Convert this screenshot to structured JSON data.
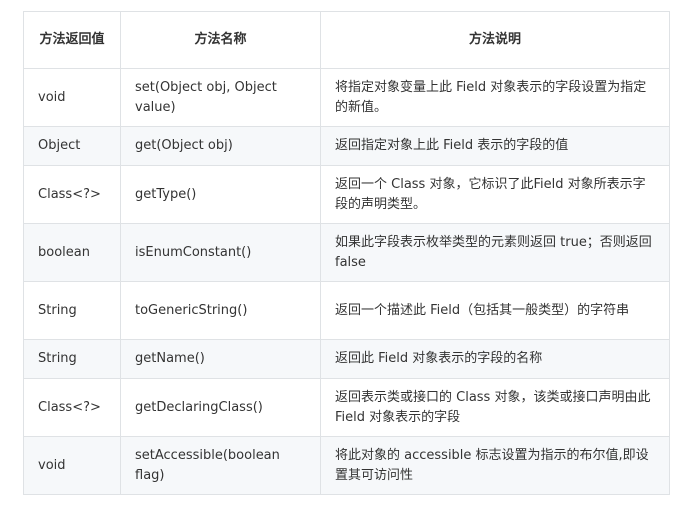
{
  "table": {
    "headers": [
      "方法返回值",
      "方法名称",
      "方法说明"
    ],
    "rows": [
      {
        "ret": "void",
        "name": "set(Object obj, Object value)",
        "desc": "将指定对象变量上此 Field 对象表示的字段设置为指定的新值。"
      },
      {
        "ret": "Object",
        "name": "get(Object obj)",
        "desc": "返回指定对象上此 Field 表示的字段的值"
      },
      {
        "ret": "Class<?>",
        "name": "getType()",
        "desc": "返回一个 Class 对象，它标识了此Field 对象所表示字段的声明类型。"
      },
      {
        "ret": "boolean",
        "name": "isEnumConstant()",
        "desc": "如果此字段表示枚举类型的元素则返回 true；否则返回 false"
      },
      {
        "ret": "String",
        "name": "toGenericString()",
        "desc": "返回一个描述此 Field（包括其一般类型）的字符串"
      },
      {
        "ret": "String",
        "name": "getName()",
        "desc": "返回此 Field 对象表示的字段的名称"
      },
      {
        "ret": "Class<?>",
        "name": "getDeclaringClass()",
        "desc": "返回表示类或接口的 Class 对象，该类或接口声明由此 Field 对象表示的字段"
      },
      {
        "ret": "void",
        "name": "setAccessible(boolean flag)",
        "desc": "将此对象的 accessible 标志设置为指示的布尔值,即设置其可访问性"
      }
    ]
  }
}
